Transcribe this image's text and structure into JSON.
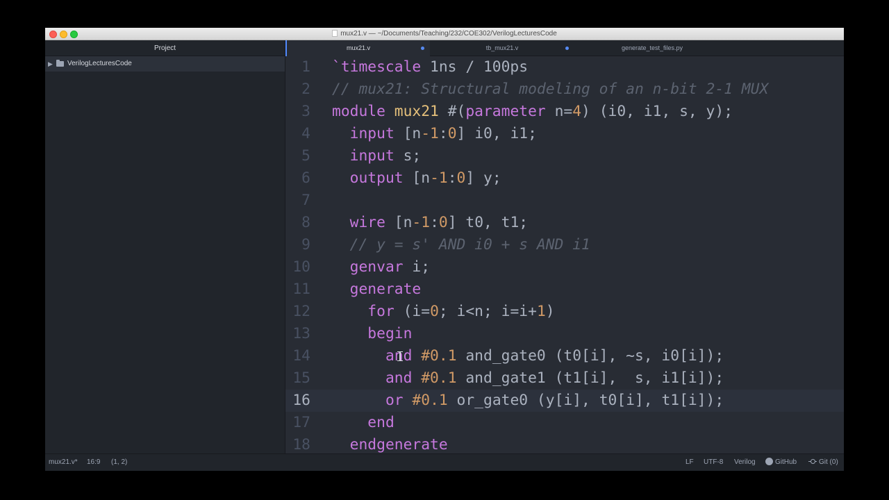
{
  "window": {
    "title": "mux21.v — ~/Documents/Teaching/232/COE302/VerilogLecturesCode"
  },
  "sidebar": {
    "header": "Project",
    "items": [
      {
        "label": "VerilogLecturesCode",
        "icon": "folder-icon",
        "expanded": false
      }
    ]
  },
  "tabs": [
    {
      "label": "mux21.v",
      "active": true,
      "modified": true
    },
    {
      "label": "tb_mux21.v",
      "active": false,
      "modified": true
    },
    {
      "label": "generate_test_files.py",
      "active": false,
      "modified": false
    }
  ],
  "editor": {
    "cursor_line": 16,
    "lines": [
      {
        "num": "1",
        "tokens": [
          [
            "`timescale",
            "kw"
          ],
          [
            " 1ns / 100ps",
            "tx"
          ]
        ]
      },
      {
        "num": "2",
        "tokens": [
          [
            "// mux21: Structural modeling of an n-bit 2-1 MUX",
            "cm"
          ]
        ]
      },
      {
        "num": "3",
        "tokens": [
          [
            "module",
            "kw"
          ],
          [
            " ",
            "tx"
          ],
          [
            "mux21",
            "fn"
          ],
          [
            " #(",
            "tx"
          ],
          [
            "parameter",
            "kw"
          ],
          [
            " n=",
            "tx"
          ],
          [
            "4",
            "nm"
          ],
          [
            ") (i0, i1, s, y);",
            "tx"
          ]
        ]
      },
      {
        "num": "4",
        "tokens": [
          [
            "  ",
            "tx"
          ],
          [
            "input",
            "kw"
          ],
          [
            " [n",
            "tx"
          ],
          [
            "-1",
            "nm"
          ],
          [
            ":",
            "tx"
          ],
          [
            "0",
            "nm"
          ],
          [
            "] i0, i1;",
            "tx"
          ]
        ]
      },
      {
        "num": "5",
        "tokens": [
          [
            "  ",
            "tx"
          ],
          [
            "input",
            "kw"
          ],
          [
            " s;",
            "tx"
          ]
        ]
      },
      {
        "num": "6",
        "tokens": [
          [
            "  ",
            "tx"
          ],
          [
            "output",
            "kw"
          ],
          [
            " [n",
            "tx"
          ],
          [
            "-1",
            "nm"
          ],
          [
            ":",
            "tx"
          ],
          [
            "0",
            "nm"
          ],
          [
            "] y;",
            "tx"
          ]
        ]
      },
      {
        "num": "7",
        "tokens": []
      },
      {
        "num": "8",
        "tokens": [
          [
            "  ",
            "tx"
          ],
          [
            "wire",
            "kw"
          ],
          [
            " [n",
            "tx"
          ],
          [
            "-1",
            "nm"
          ],
          [
            ":",
            "tx"
          ],
          [
            "0",
            "nm"
          ],
          [
            "] t0, t1;",
            "tx"
          ]
        ]
      },
      {
        "num": "9",
        "tokens": [
          [
            "  ",
            "tx"
          ],
          [
            "// y = s' AND i0 + s AND i1",
            "cm"
          ]
        ]
      },
      {
        "num": "10",
        "tokens": [
          [
            "  ",
            "tx"
          ],
          [
            "genvar",
            "kw"
          ],
          [
            " i;",
            "tx"
          ]
        ]
      },
      {
        "num": "11",
        "tokens": [
          [
            "  ",
            "tx"
          ],
          [
            "generate",
            "kw"
          ]
        ]
      },
      {
        "num": "12",
        "tokens": [
          [
            "    ",
            "tx"
          ],
          [
            "for",
            "kw"
          ],
          [
            " (i=",
            "tx"
          ],
          [
            "0",
            "nm"
          ],
          [
            "; i<n; i=i+",
            "tx"
          ],
          [
            "1",
            "nm"
          ],
          [
            ")",
            "tx"
          ]
        ]
      },
      {
        "num": "13",
        "tokens": [
          [
            "    ",
            "tx"
          ],
          [
            "begin",
            "kw"
          ]
        ]
      },
      {
        "num": "14",
        "tokens": [
          [
            "      ",
            "tx"
          ],
          [
            "and",
            "kw"
          ],
          [
            " ",
            "tx"
          ],
          [
            "#0.1",
            "nm"
          ],
          [
            " and_gate0 (t0[i], ~s, i0[i]);",
            "tx"
          ]
        ]
      },
      {
        "num": "15",
        "tokens": [
          [
            "      ",
            "tx"
          ],
          [
            "and",
            "kw"
          ],
          [
            " ",
            "tx"
          ],
          [
            "#0.1",
            "nm"
          ],
          [
            " and_gate1 (t1[i],  s, i1[i]);",
            "tx"
          ]
        ]
      },
      {
        "num": "16",
        "tokens": [
          [
            "      ",
            "tx"
          ],
          [
            "or",
            "kw"
          ],
          [
            " ",
            "tx"
          ],
          [
            "#0.1",
            "nm"
          ],
          [
            " or_gate0 (y[i], t0[i], t1[i]);",
            "tx"
          ]
        ]
      },
      {
        "num": "17",
        "tokens": [
          [
            "    ",
            "tx"
          ],
          [
            "end",
            "kw"
          ]
        ]
      },
      {
        "num": "18",
        "tokens": [
          [
            "  ",
            "tx"
          ],
          [
            "endgenerate",
            "kw"
          ]
        ]
      }
    ]
  },
  "statusbar": {
    "file": "mux21.v*",
    "position": "16:9",
    "selection": "(1, 2)",
    "line_ending": "LF",
    "encoding": "UTF-8",
    "grammar": "Verilog",
    "github": "GitHub",
    "git": "Git (0)"
  },
  "colors": {
    "kw": "#c678dd",
    "tx": "#abb2bf",
    "cm": "#5c6370",
    "nm": "#d19a66",
    "fn": "#e5c07b",
    "accent": "#528bff"
  }
}
